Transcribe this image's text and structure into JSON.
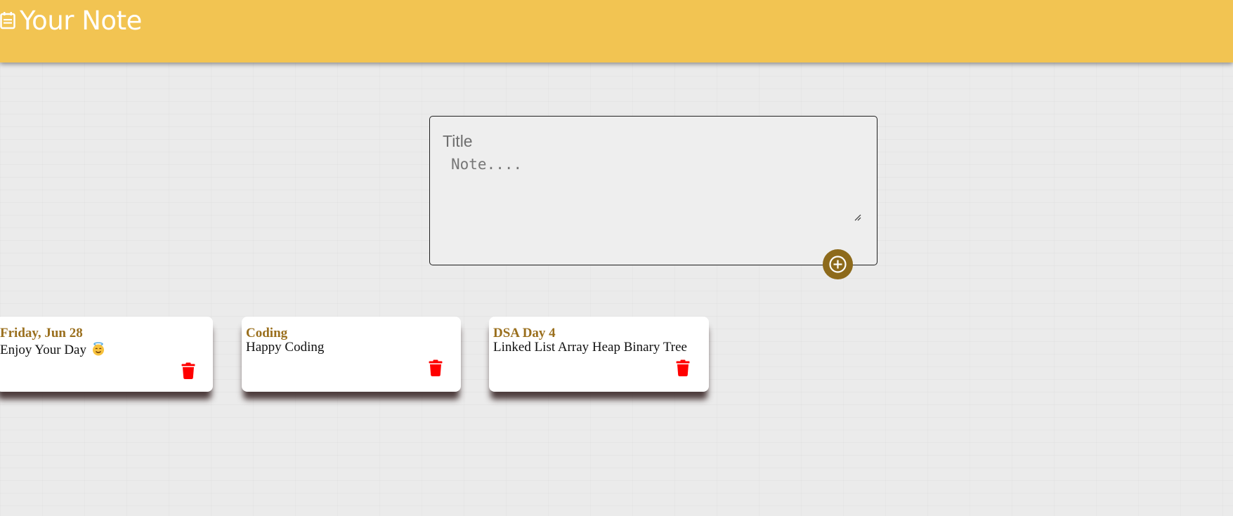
{
  "header": {
    "title": "Your Note",
    "icon": "note-icon",
    "background_color": "#f2c452"
  },
  "composer": {
    "title_placeholder": "Title",
    "note_placeholder": "Note....",
    "title_value": "",
    "note_value": "",
    "add_icon": "plus-circle-icon",
    "add_button_color": "#8d6a1b"
  },
  "notes": [
    {
      "title": "Friday, Jun 28",
      "body": "Enjoy Your Day",
      "emoji": "smiling-face-with-halo-icon",
      "delete_icon": "trash-icon"
    },
    {
      "title": "Coding",
      "body": "Happy Coding",
      "delete_icon": "trash-icon"
    },
    {
      "title": "DSA Day 4",
      "body": "Linked List Array Heap Binary Tree",
      "delete_icon": "trash-icon"
    }
  ],
  "colors": {
    "note_title": "#9a6f1d",
    "delete_icon": "#ff0000"
  }
}
